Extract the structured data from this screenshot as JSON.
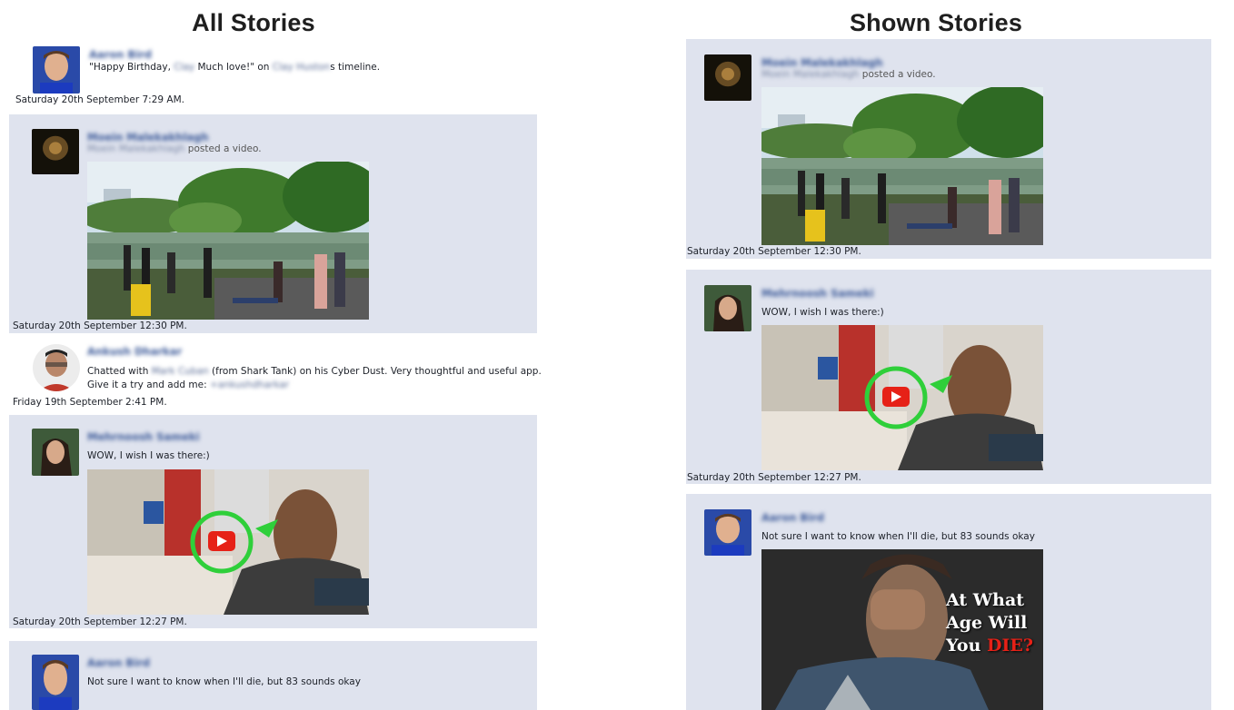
{
  "headings": {
    "all": "All Stories",
    "shown": "Shown Stories"
  },
  "all_stories": [
    {
      "author": "Aaron Bird",
      "text_parts": [
        "\"Happy Birthday, ",
        "Clay",
        " Much love!\" on ",
        "Clay Huston",
        "s timeline."
      ],
      "timestamp": "Saturday 20th September 7:29 AM."
    },
    {
      "author": "Moein Malekakhlagh",
      "meta_parts": [
        "Moein Malekakhlagh",
        " posted a video."
      ],
      "timestamp": "Saturday 20th September 12:30 PM."
    },
    {
      "author": "Ankush Dharkar",
      "line1_parts": [
        "Chatted with ",
        "Mark Cuban",
        " (from Shark Tank) on his Cyber Dust. Very thoughtful and useful app."
      ],
      "line2_parts": [
        "Give it a try and add me: ",
        "+ankushdharkar"
      ],
      "timestamp": "Friday 19th September 2:41 PM."
    },
    {
      "author": "Mehrnoosh Sameki",
      "text": "WOW, I wish I was there:)",
      "timestamp": "Saturday 20th September 12:27 PM."
    },
    {
      "author": "Aaron Bird",
      "text": "Not sure I want to know when I'll die, but 83 sounds okay"
    }
  ],
  "shown_stories": [
    {
      "author": "Moein Malekakhlagh",
      "meta_parts": [
        "Moein Malekakhlagh",
        " posted a video."
      ],
      "timestamp": "Saturday 20th September 12:30 PM."
    },
    {
      "author": "Mehrnoosh Sameki",
      "text": "WOW, I wish I was there:)",
      "timestamp": "Saturday 20th September 12:27 PM."
    },
    {
      "author": "Aaron Bird",
      "text": "Not sure I want to know when I'll die, but 83 sounds okay",
      "image_text": [
        "At What",
        "Age Will",
        "You",
        "DIE?"
      ]
    }
  ],
  "colors": {
    "panel": "#dfe3ee",
    "name_link": "#3b5998",
    "play_button": "#e62117"
  }
}
